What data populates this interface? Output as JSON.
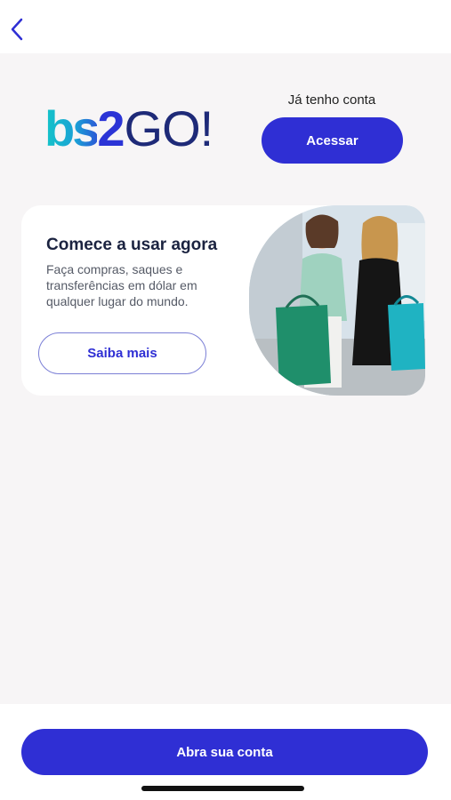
{
  "header": {
    "back_icon": "chevron-left-icon"
  },
  "brand": {
    "logo_bs": "bs",
    "logo_2": "2",
    "logo_go": "GO!"
  },
  "login": {
    "prompt": "Já tenho conta",
    "button_label": "Acessar"
  },
  "promo": {
    "title": "Comece a usar agora",
    "description": "Faça compras, saques e transferências em dólar em qualquer lugar do mundo.",
    "button_label": "Saiba mais",
    "image": "two-women-shopping-bags-photo"
  },
  "footer": {
    "button_label": "Abra sua conta"
  },
  "colors": {
    "primary": "#2f2fd4",
    "background": "#f7f5f6",
    "card": "#ffffff"
  }
}
